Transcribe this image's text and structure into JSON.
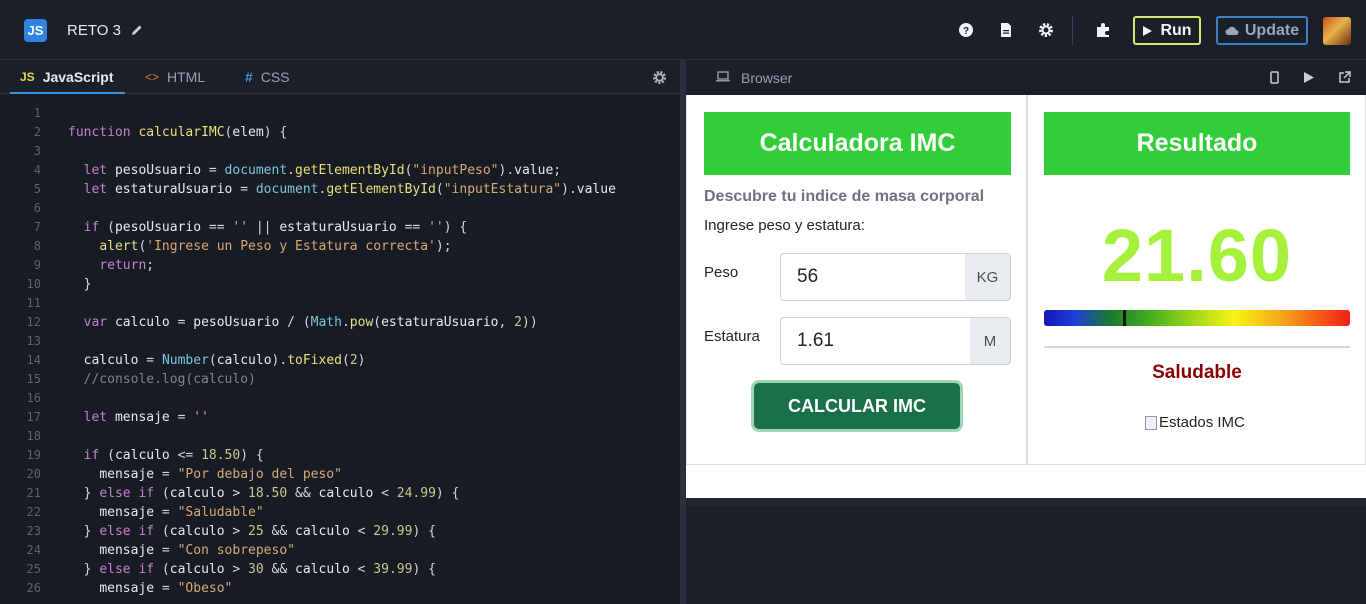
{
  "app": {
    "logo_text": "JS",
    "project_title": "RETO 3"
  },
  "toolbar": {
    "run_label": "Run",
    "update_label": "Update"
  },
  "editor": {
    "tabs": [
      {
        "label": "JavaScript",
        "prefix": "JS"
      },
      {
        "label": "HTML",
        "prefix": "<>"
      },
      {
        "label": "CSS",
        "prefix": "#"
      }
    ],
    "line_numbers": [
      "1",
      "2",
      "3",
      "4",
      "5",
      "6",
      "7",
      "8",
      "9",
      "10",
      "11",
      "12",
      "13",
      "14",
      "15",
      "16",
      "17",
      "18",
      "19",
      "20",
      "21",
      "22",
      "23",
      "24",
      "25",
      "26"
    ]
  },
  "browser": {
    "tab_label": "Browser"
  },
  "calculator": {
    "title": "Calculadora IMC",
    "subtitle": "Descubre tu indice de masa corporal",
    "hint": "Ingrese peso y estatura:",
    "peso_label": "Peso",
    "peso_value": "56",
    "peso_unit": "KG",
    "estatura_label": "Estatura",
    "estatura_value": "1.61",
    "estatura_unit": "M",
    "button_label": "CALCULAR IMC"
  },
  "result": {
    "title": "Resultado",
    "imc_value": "21.60",
    "status": "Saludable",
    "image_alt": "Estados IMC"
  },
  "colors": {
    "green_header": "#31ce3a",
    "imc_value": "#a4f03a",
    "status": "#8b0000",
    "button": "#1a7048"
  }
}
